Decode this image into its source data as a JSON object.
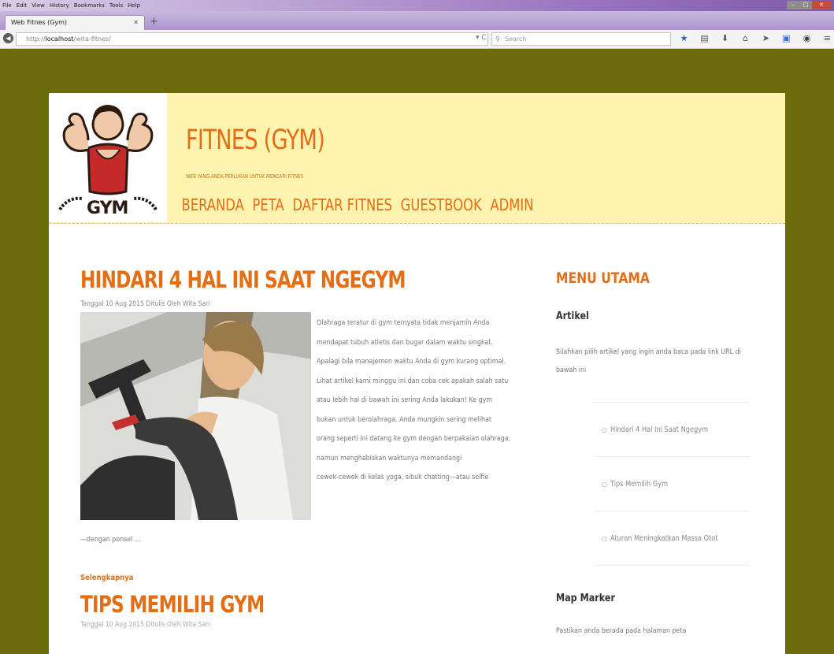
{
  "browser": {
    "menu": [
      "File",
      "Edit",
      "View",
      "History",
      "Bookmarks",
      "Tools",
      "Help"
    ],
    "tab_title": "Web Fitnes (Gym)",
    "url_prefix": "http://",
    "url_host": "localhost",
    "url_path": "/wita-fitnes/",
    "search_placeholder": "Search"
  },
  "site": {
    "title": "FITNES (GYM)",
    "tagline": "WEB YANG ANDA PERLUKAN UNTUK MENCARI FITNES",
    "logo_text": "GYM",
    "nav": [
      "BERANDA",
      "PETA",
      "DAFTAR FITNES",
      "GUESTBOOK",
      "ADMIN"
    ]
  },
  "posts": [
    {
      "title": "HINDARI 4 HAL INI SAAT NGEGYM",
      "meta": "Tanggal 10 Aug 2015 Ditulis Oleh Wita Sari",
      "excerpt_lines": [
        "Olahraga teratur di gym ternyata tidak menjamin Anda",
        "mendapat tubuh atletis dan bugar dalam waktu singkat.",
        "Apalagi bila manajemen waktu Anda di gym kurang optimal.",
        "Lihat artikel kami minggu ini dan coba cek apakah salah satu",
        "atau lebih hal di bawah ini sering Anda lakukan! Ke gym",
        "bukan untuk berolahraga. Anda mungkin sering melihat",
        "orang seperti ini datang ke gym dengan berpakaian olahraga,",
        "namun menghabiskan waktunya memandangi",
        "cewek-cewek di kelas yoga, sibuk chatting—atau selfie"
      ],
      "excerpt_tail": "—dengan ponsel …",
      "read_more": "Selengkapnya"
    },
    {
      "title": "TIPS MEMILIH GYM",
      "meta": "Tanggal 10 Aug 2015 Ditulis Oleh Wita Sari"
    }
  ],
  "sidebar": {
    "title": "MENU UTAMA",
    "artikel": {
      "heading": "Artikel",
      "desc": "Silahkan pilih artikel yang ingin anda baca pada link URL di bawah ini",
      "links": [
        "Hindari 4 Hal Ini Saat Ngegym",
        "Tips Memilih Gym",
        "Aturan Meningkatkan Massa Otot"
      ]
    },
    "map": {
      "heading": "Map Marker",
      "desc": "Pastikan anda berada pada halaman peta"
    }
  },
  "colors": {
    "accent": "#e36e15",
    "header_bg": "#fff3b0",
    "page_bg": "#6b6b0b"
  }
}
